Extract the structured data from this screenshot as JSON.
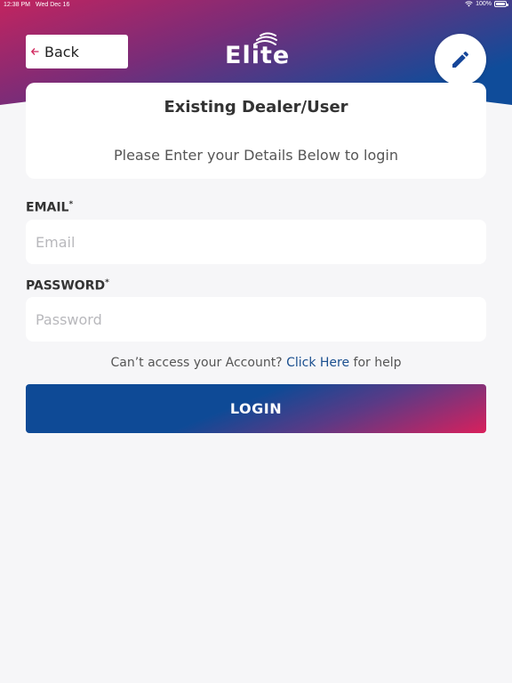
{
  "status_bar": {
    "time": "12:38 PM",
    "date": "Wed Dec 16",
    "battery": "100%",
    "wifi_icon": "wifi-icon",
    "battery_icon": "battery-icon"
  },
  "header": {
    "back_label": "Back",
    "back_icon": "arrow-left-icon",
    "logo_text": "Elite",
    "edit_icon": "pencil-icon"
  },
  "card": {
    "title": "Existing Dealer/User",
    "subtitle": "Please Enter your Details Below to login"
  },
  "form": {
    "email": {
      "label": "EMAIL",
      "required_mark": "*",
      "placeholder": "Email",
      "value": ""
    },
    "password": {
      "label": "PASSWORD",
      "required_mark": "*",
      "placeholder": "Password",
      "value": ""
    }
  },
  "help": {
    "prefix": "Can’t access your Account?",
    "link": "Click Here",
    "suffix": "for help"
  },
  "login_label": "LOGIN",
  "colors": {
    "brand_blue": "#0e4a96",
    "brand_pink": "#d9205c",
    "link": "#1a4f8f",
    "background": "#f6f6f8"
  }
}
